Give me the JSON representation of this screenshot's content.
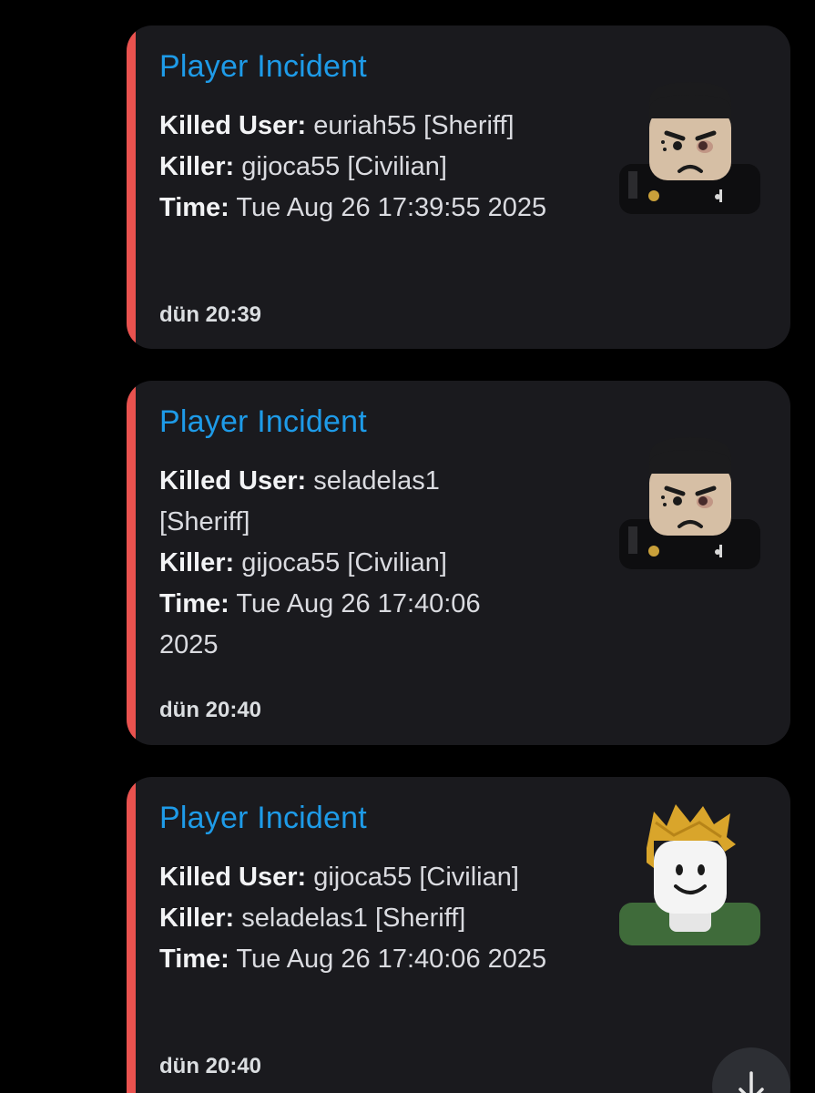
{
  "accent_colors": {
    "embed_bar": "#e9524f",
    "title": "#1e9be8",
    "background": "#000000",
    "card": "#1a1a1e"
  },
  "incidents": [
    {
      "title": "Player Incident",
      "killed_label": "Killed User:",
      "killed_value": " euriah55 [Sheriff]",
      "killer_label": "Killer:",
      "killer_value": " gijoca55 [Civilian]",
      "time_label": "Time:",
      "time_value": " Tue Aug 26 17:39:55 2025",
      "footer": "dün 20:39",
      "avatar": "sheriff-avatar-icon"
    },
    {
      "title": "Player Incident",
      "killed_label": "Killed User:",
      "killed_value": " seladelas1 [Sheriff]",
      "killer_label": "Killer:",
      "killer_value": " gijoca55 [Civilian]",
      "time_label": "Time:",
      "time_value": " Tue Aug 26 17:40:06 2025",
      "footer": "dün 20:40",
      "avatar": "sheriff-avatar-icon"
    },
    {
      "title": "Player Incident",
      "killed_label": "Killed User:",
      "killed_value": " gijoca55 [Civilian]",
      "killer_label": "Killer:",
      "killer_value": " seladelas1 [Sheriff]",
      "time_label": "Time:",
      "time_value": " Tue Aug 26 17:40:06 2025",
      "footer": "dün 20:40",
      "avatar": "blonde-avatar-icon"
    }
  ],
  "scroll_button": {
    "icon": "arrow-down-icon"
  }
}
